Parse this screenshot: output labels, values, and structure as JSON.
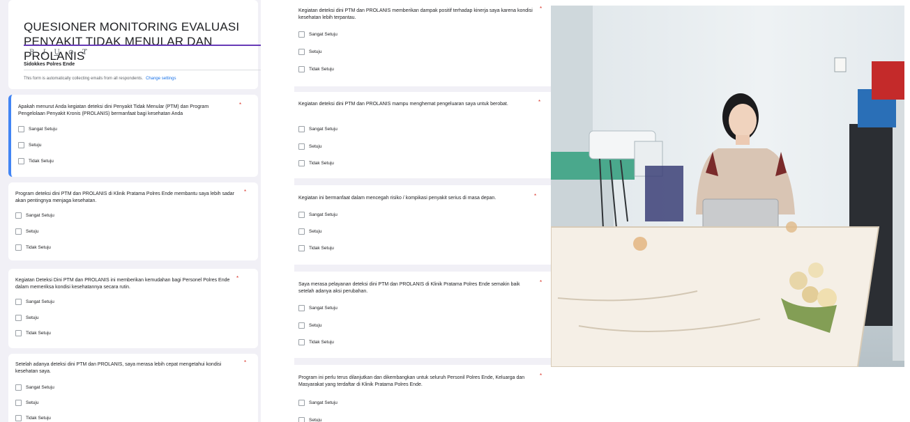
{
  "form": {
    "title": "QUESIONER MONITORING EVALUASI PENYAKIT TIDAK MENULAR DAN PROLANIS",
    "toolbar": [
      "B",
      "I",
      "U",
      "⊘",
      "T̸"
    ],
    "organization": "Sidokkes Polres Ende",
    "email_note": "This form is automatically collecting emails from all respondents.",
    "email_link": "Change settings",
    "required_mark": "*",
    "options": [
      "Sangat Setuju",
      "Setuju",
      "Tidak Setuju"
    ]
  },
  "questions": [
    {
      "text": "Apakah menurut Anda kegiatan deteksi dini Penyakit Tidak Menular (PTM) dan Program Pengelolaan Penyakit Kronis (PROLANIS)  bermanfaat bagi kesehatan Anda"
    },
    {
      "text": "Program deteksi dini PTM dan PROLANIS di Klinik Pratama Polres Ende membantu saya lebih sadar akan pentingnya menjaga kesehatan."
    },
    {
      "text": "Kegiatan Deteksi Dini PTM dan PROLANIS ini memberikan kemudahan bagi Personel Polres Ende dalam memeriksa kondisi kesehatannya secara rutin."
    },
    {
      "text": "Setelah adanya deteksi dini PTM dan PROLANIS, saya merasa lebih cepat mengetahui kondisi kesehatan saya."
    },
    {
      "text": "Kegiatan deteksi dini PTM dan PROLANIS memberikan dampak positif terhadap kinerja saya karena kondisi kesehatan lebih terpantau."
    },
    {
      "text": "Kegiatan deteksi dini PTM dan PROLANIS mampu menghemat pengeluaran saya untuk berobat."
    },
    {
      "text": "Kegiatan ini bermanfaat dalam mencegah risiko / kompikasi penyakit serius di masa depan."
    },
    {
      "text": "Saya merasa pelayanan deteksi dini PTM dan PROLANIS  di Klinik Pratama Polres Ende semakin baik setelah adanya aksi perubahan."
    },
    {
      "text": " Program ini perlu terus dilanjutkan dan dikembangkan untuk seluruh Personil Polres Ende, Keluarga dan Masyarakat yang terdaftar di Klinik Pratama Polres Ende."
    }
  ],
  "colors": {
    "accent": "#673ab7",
    "focus": "#4285f4",
    "required": "#d93025",
    "link": "#1a73e8",
    "background": "#f1f0f6"
  }
}
